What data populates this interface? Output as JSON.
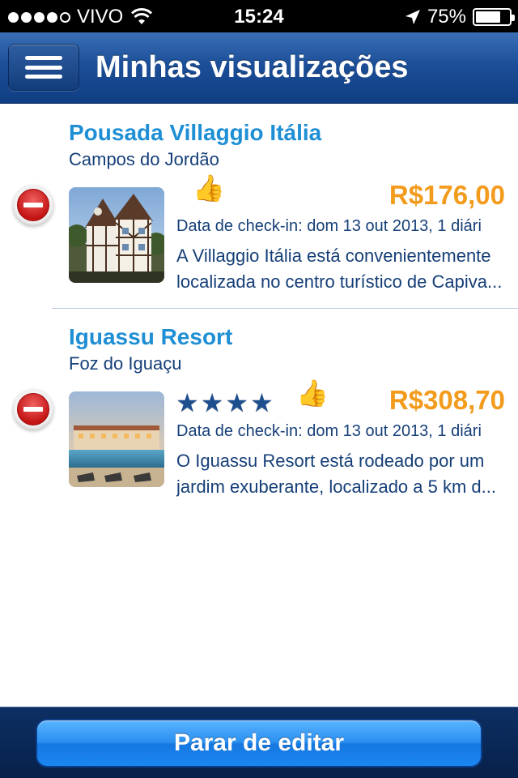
{
  "status_bar": {
    "carrier": "VIVO",
    "time": "15:24",
    "battery_percent": "75%",
    "signal_bars": 4,
    "signal_total": 5,
    "battery_level": 0.75
  },
  "nav": {
    "title": "Minhas visualizações",
    "menu_icon": "hamburger-menu-icon"
  },
  "hotels": [
    {
      "name": "Pousada Villaggio Itália",
      "city": "Campos do Jordão",
      "price": "R$176,00",
      "checkin": "Data de check-in: dom 13 out 2013, 1 diári",
      "description_lines": [
        "A Villaggio Itália está convenientemente",
        "localizada no centro turístico de Capiva..."
      ],
      "stars": 0,
      "thumbs_up": true
    },
    {
      "name": "Iguassu Resort",
      "city": "Foz do Iguaçu",
      "price": "R$308,70",
      "checkin": "Data de check-in: dom 13 out 2013, 1 diári",
      "description_lines": [
        "O Iguassu Resort está rodeado por um",
        "jardim exuberante, localizado a 5 km d..."
      ],
      "stars": 4,
      "thumbs_up": true
    }
  ],
  "bottom": {
    "stop_editing_label": "Parar de editar"
  },
  "colors": {
    "nav_blue": "#1c4f98",
    "title_blue": "#1e8fd4",
    "text_navy": "#163f78",
    "price_orange": "#f29b1c",
    "delete_red": "#c41414",
    "button_blue": "#2a8ff0"
  }
}
